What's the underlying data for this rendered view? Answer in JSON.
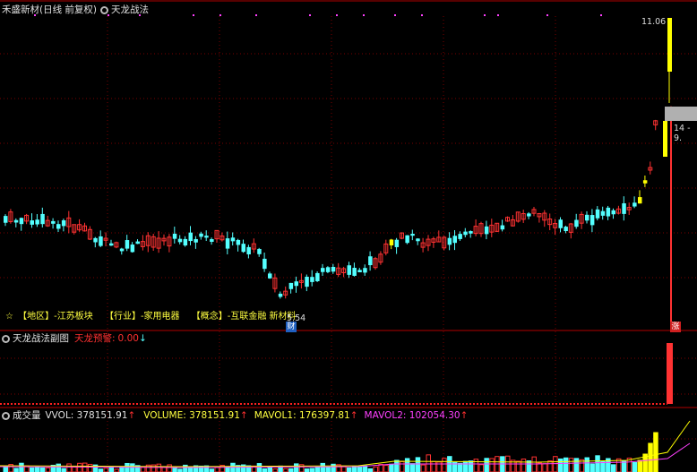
{
  "main_panel": {
    "stock_name": "禾盛新材(日线 前复权)",
    "indicator_name": "天龙战法",
    "high_label": "11.06",
    "low_label": "5.54",
    "price_tag": "14 - 9.",
    "finance_badge": "财",
    "limit_badge": "涨",
    "star": "☆",
    "region": "【地区】-江苏板块",
    "industry": "【行业】-家用电器",
    "concept": "【概念】-互联金融 新材料"
  },
  "sub_panel": {
    "title": "天龙战法副图",
    "label": "天龙预警:",
    "value": "0.00",
    "arrow": "↓"
  },
  "volume_panel": {
    "title": "成交量",
    "vol_text": "VVOL: 378151.91",
    "vol_arrow": "↑",
    "volume_text": "VOLUME: 378151.91",
    "volume_arrow": "↑",
    "mavol1_text": "MAVOL1: 176397.81",
    "mavol1_arrow": "↑",
    "mavol2_text": "MAVOL2: 102054.30",
    "mavol2_arrow": "↑"
  },
  "colors": {
    "up": "#ff3232",
    "down": "#54ffff",
    "signal": "#ffff00",
    "grid": "#7a0000",
    "magenta": "#ff40ff"
  }
}
